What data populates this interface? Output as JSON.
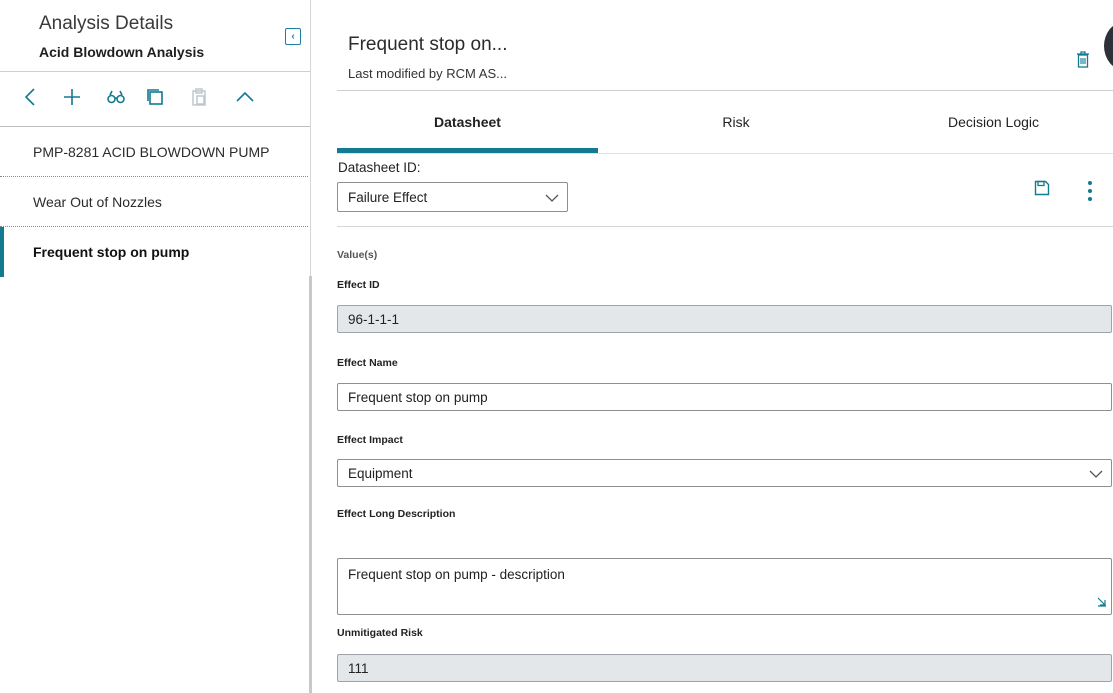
{
  "left_panel": {
    "title": "Analysis Details",
    "subtitle": "Acid Blowdown Analysis",
    "collapse_icon": "chevron-left-box-icon",
    "toolbar": [
      {
        "name": "back-icon"
      },
      {
        "name": "add-icon"
      },
      {
        "name": "binoculars-icon"
      },
      {
        "name": "copy-icon"
      },
      {
        "name": "paste-icon"
      },
      {
        "name": "chevron-up-icon"
      }
    ],
    "tree": [
      {
        "label": "PMP-8281 ACID BLOWDOWN PUMP",
        "active": false
      },
      {
        "label": "Wear Out of Nozzles",
        "active": false
      },
      {
        "label": "Frequent stop on pump",
        "active": true
      }
    ]
  },
  "header": {
    "title": "Frequent stop on...",
    "modified": "Last modified by RCM AS..."
  },
  "tabs": [
    {
      "label": "Datasheet",
      "active": true
    },
    {
      "label": "Risk",
      "active": false
    },
    {
      "label": "Decision Logic",
      "active": false
    }
  ],
  "datasheet": {
    "id_label": "Datasheet ID:",
    "id_value": "Failure Effect"
  },
  "form": {
    "values_label": "Value(s)",
    "effect_id_label": "Effect ID",
    "effect_id_value": "96-1-1-1",
    "effect_name_label": "Effect Name",
    "effect_name_value": "Frequent stop on pump",
    "effect_impact_label": "Effect Impact",
    "effect_impact_value": "Equipment",
    "long_desc_label": "Effect Long Description",
    "long_desc_value": "Frequent stop on pump - description",
    "unmitigated_risk_label": "Unmitigated Risk",
    "unmitigated_risk_value": "111"
  },
  "colors": {
    "accent": "#127a91",
    "readonly_bg": "#e4e7ea"
  }
}
